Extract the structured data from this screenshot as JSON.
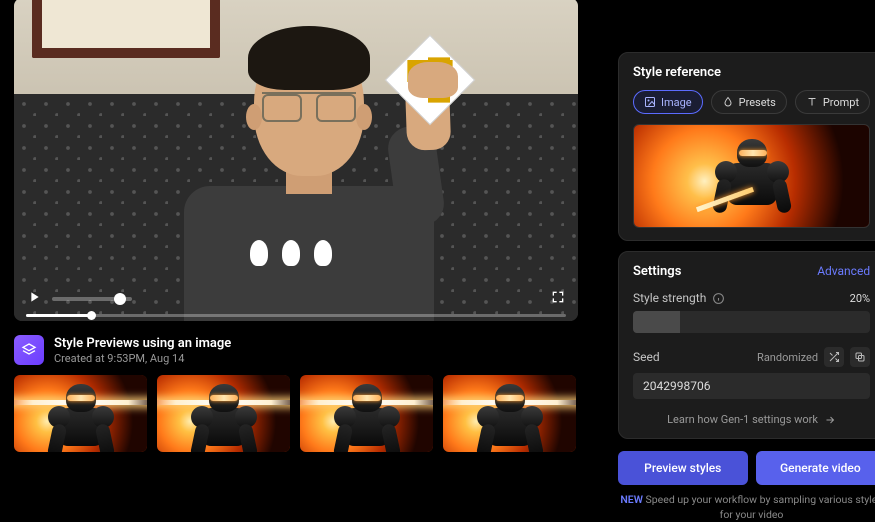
{
  "video": {
    "volume_pct": 85,
    "progress_pct": 12
  },
  "previews": {
    "title": "Style Previews using an image",
    "subtitle": "Created at 9:53PM, Aug 14",
    "count": 4
  },
  "style_reference": {
    "title": "Style reference",
    "tabs": {
      "image": "Image",
      "presets": "Presets",
      "prompt": "Prompt"
    },
    "active_tab": "image"
  },
  "settings": {
    "title": "Settings",
    "advanced_label": "Advanced",
    "style_strength": {
      "label": "Style strength",
      "value_text": "20%",
      "value_pct": 20
    },
    "seed": {
      "label": "Seed",
      "mode": "Randomized",
      "value": "2042998706"
    },
    "learn_link": "Learn how Gen-1 settings work"
  },
  "actions": {
    "preview": "Preview styles",
    "generate": "Generate video"
  },
  "footer": {
    "new_tag": "NEW",
    "text": "Speed up your workflow by sampling various styles for your video"
  }
}
